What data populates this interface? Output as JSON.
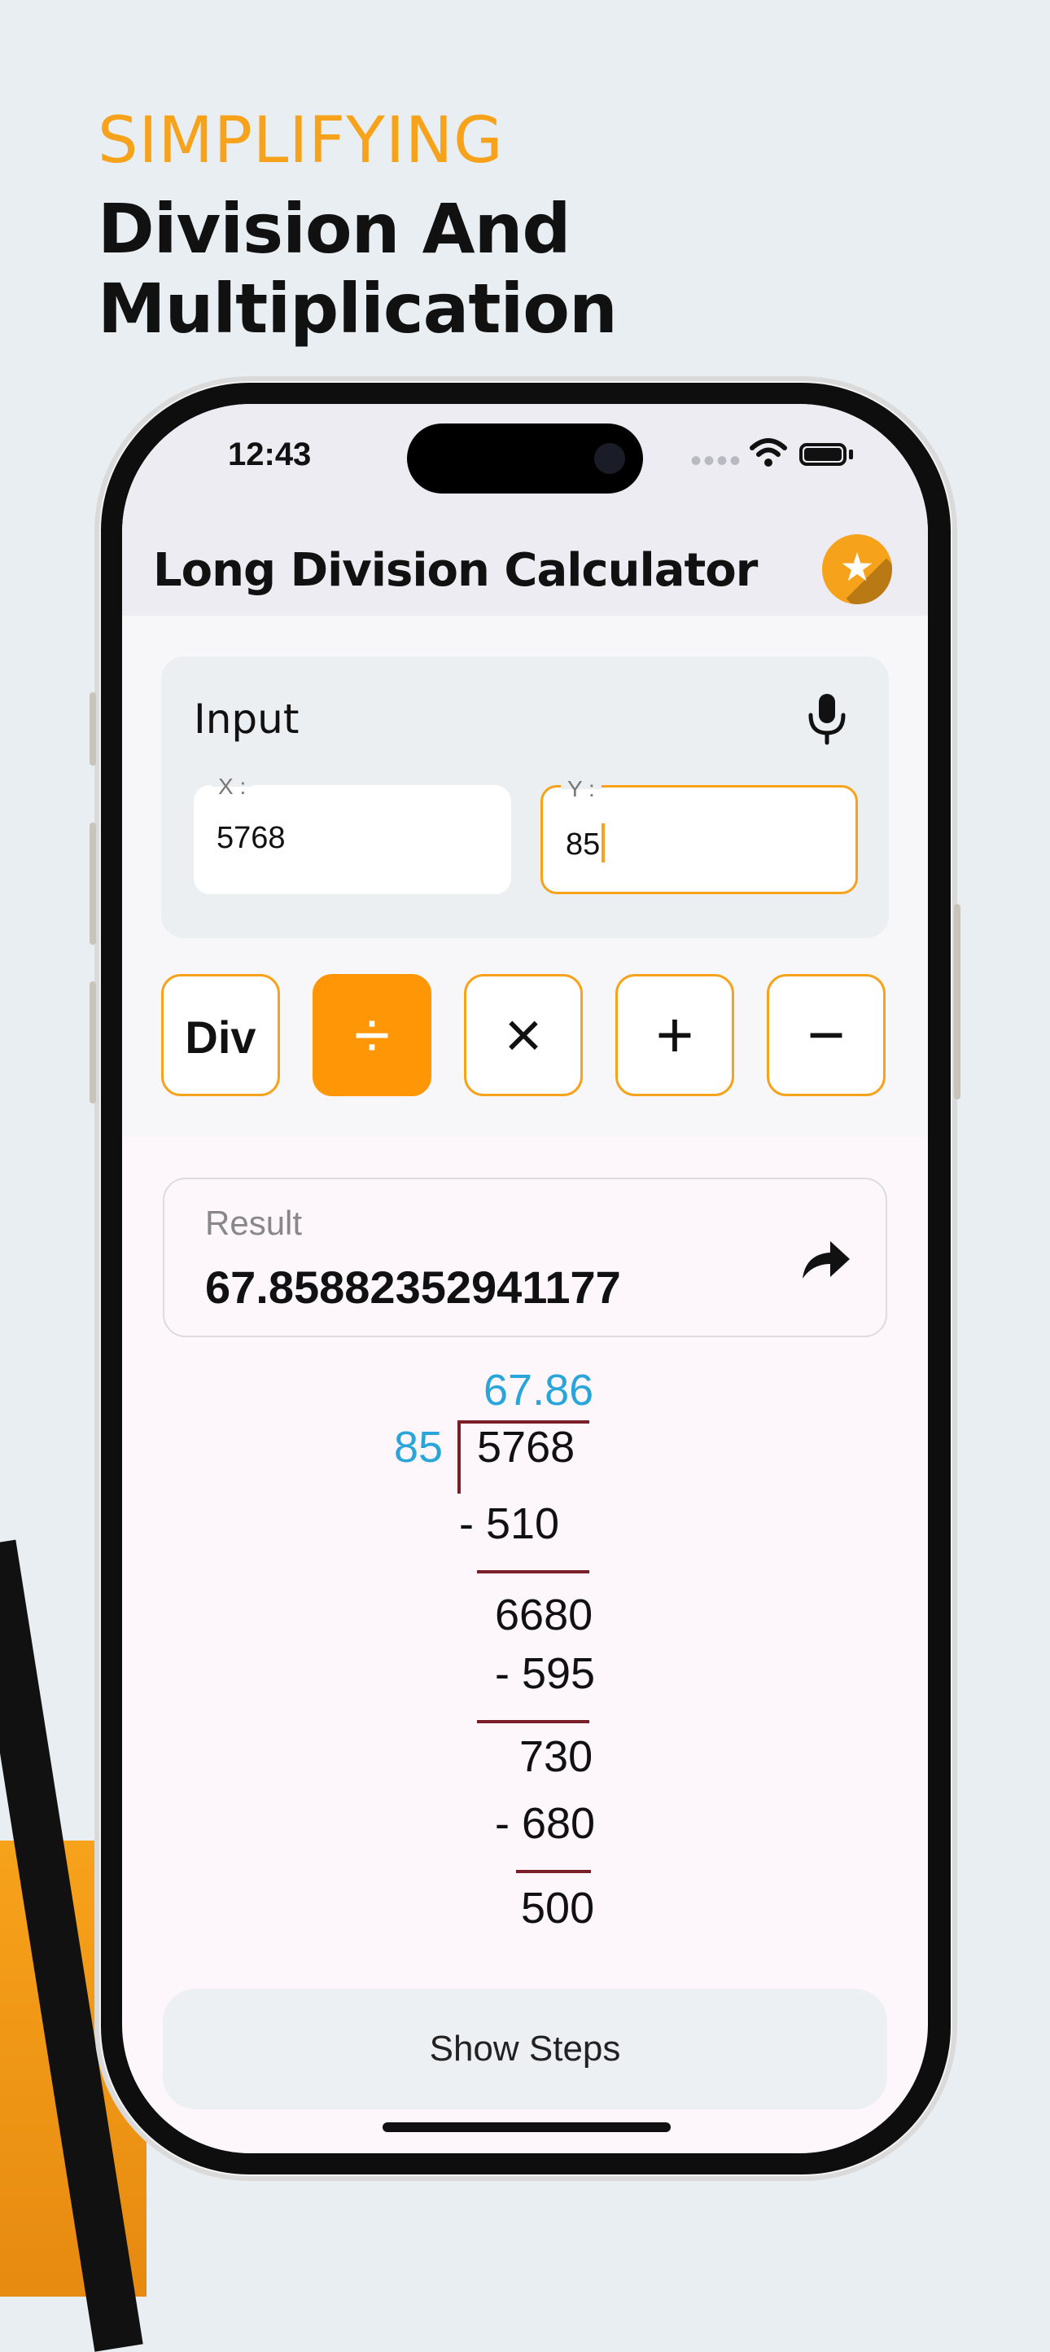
{
  "promo": {
    "kicker": "SIMPLIFYING",
    "headline": "Division And Multiplication"
  },
  "status_bar": {
    "time": "12:43",
    "signal_dots": "••••"
  },
  "app_bar": {
    "title": "Long Division Calculator",
    "favorite_icon": "star-icon"
  },
  "input": {
    "label": "Input",
    "mic_icon": "microphone-icon",
    "x": {
      "legend": "X :",
      "value": "5768"
    },
    "y": {
      "legend": "Y :",
      "value": "85"
    }
  },
  "operations": [
    {
      "label": "Div",
      "icon": "div-text",
      "active": false
    },
    {
      "label": "÷",
      "icon": "divide-icon",
      "active": true
    },
    {
      "label": "×",
      "icon": "multiply-icon",
      "active": false
    },
    {
      "label": "+",
      "icon": "plus-icon",
      "active": false
    },
    {
      "label": "−",
      "icon": "minus-icon",
      "active": false
    }
  ],
  "result": {
    "label": "Result",
    "value": "67.85882352941177",
    "share_icon": "share-icon"
  },
  "long_division": {
    "quotient": "67.86",
    "divisor": "85",
    "dividend": "5768",
    "steps": [
      "- 510",
      "6680",
      "- 595",
      "730",
      "- 680",
      "500"
    ]
  },
  "steps_button": {
    "label": "Show Steps"
  },
  "colors": {
    "accent": "#f7a21b",
    "active_op": "#ff9606",
    "quotient_blue": "#2aa5d9",
    "rule_line": "#7a1f2a"
  }
}
